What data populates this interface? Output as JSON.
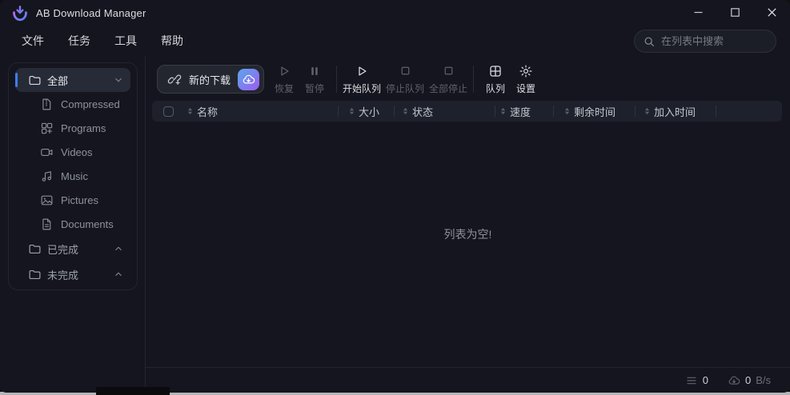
{
  "window": {
    "title": "AB Download Manager",
    "controls": {
      "minimize": "minimize",
      "maximize": "maximize",
      "close": "close"
    }
  },
  "menu": {
    "items": [
      "文件",
      "任务",
      "工具",
      "帮助"
    ]
  },
  "search": {
    "placeholder": "在列表中搜索"
  },
  "sidebar": {
    "groups": [
      {
        "label": "全部",
        "selected": true,
        "chevron": "down",
        "children": [
          {
            "label": "Compressed"
          },
          {
            "label": "Programs"
          },
          {
            "label": "Videos"
          },
          {
            "label": "Music"
          },
          {
            "label": "Pictures"
          },
          {
            "label": "Documents"
          }
        ]
      },
      {
        "label": "已完成",
        "selected": false,
        "chevron": "up",
        "children": []
      },
      {
        "label": "未完成",
        "selected": false,
        "chevron": "up",
        "children": []
      }
    ]
  },
  "toolbar": {
    "new_download_label": "新的下载",
    "buttons": [
      {
        "label": "恢复",
        "icon": "play",
        "enabled": false
      },
      {
        "label": "暂停",
        "icon": "pause",
        "enabled": false
      },
      {
        "label": "开始队列",
        "icon": "play",
        "enabled": true
      },
      {
        "label": "停止队列",
        "icon": "stop",
        "enabled": false
      },
      {
        "label": "全部停止",
        "icon": "stop",
        "enabled": false
      },
      {
        "label": "队列",
        "icon": "queue-grid",
        "enabled": true
      },
      {
        "label": "设置",
        "icon": "gear",
        "enabled": true
      }
    ]
  },
  "table": {
    "columns": [
      "名称",
      "大小",
      "状态",
      "速度",
      "剩余时间",
      "加入时间"
    ],
    "empty_text": "列表为空!"
  },
  "statusbar": {
    "queue_count": "0",
    "speed_value": "0",
    "speed_unit": "B/s"
  },
  "colors": {
    "accent_blue": "#3f7df6",
    "gradient_start": "#58a8ec",
    "gradient_end": "#9f5bf2",
    "window_bg": "#14151e",
    "header_row_bg": "#1e202b"
  }
}
